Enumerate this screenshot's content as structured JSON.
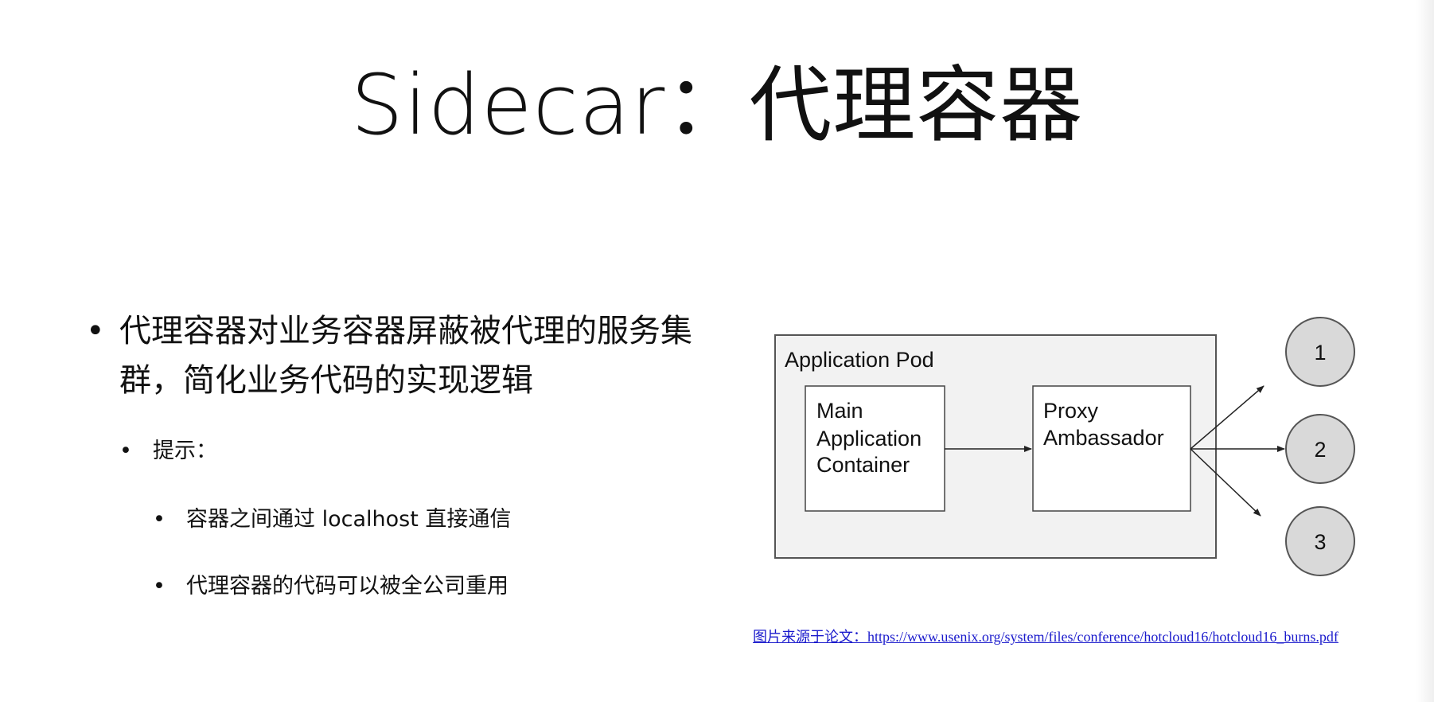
{
  "slide": {
    "title": "Sidecar：代理容器",
    "bullets": {
      "main": "代理容器对业务容器屏蔽被代理的服务集群，简化业务代码的实现逻辑",
      "hint_label": "提示：",
      "sub_items": [
        "容器之间通过 localhost 直接通信",
        "代理容器的代码可以被全公司重用"
      ]
    }
  },
  "diagram": {
    "pod_label": "Application Pod",
    "main_container_lines": [
      "Main",
      "Application",
      "Container"
    ],
    "proxy_lines": [
      "Proxy",
      "Ambassador"
    ],
    "nodes": [
      "1",
      "2",
      "3"
    ]
  },
  "caption": "图片来源于论文：https://www.usenix.org/system/files/conference/hotcloud16/hotcloud16_burns.pdf",
  "colors": {
    "pod_fill": "#f2f2f2",
    "node_fill": "#d9d9d9",
    "link": "#1a1acc"
  }
}
